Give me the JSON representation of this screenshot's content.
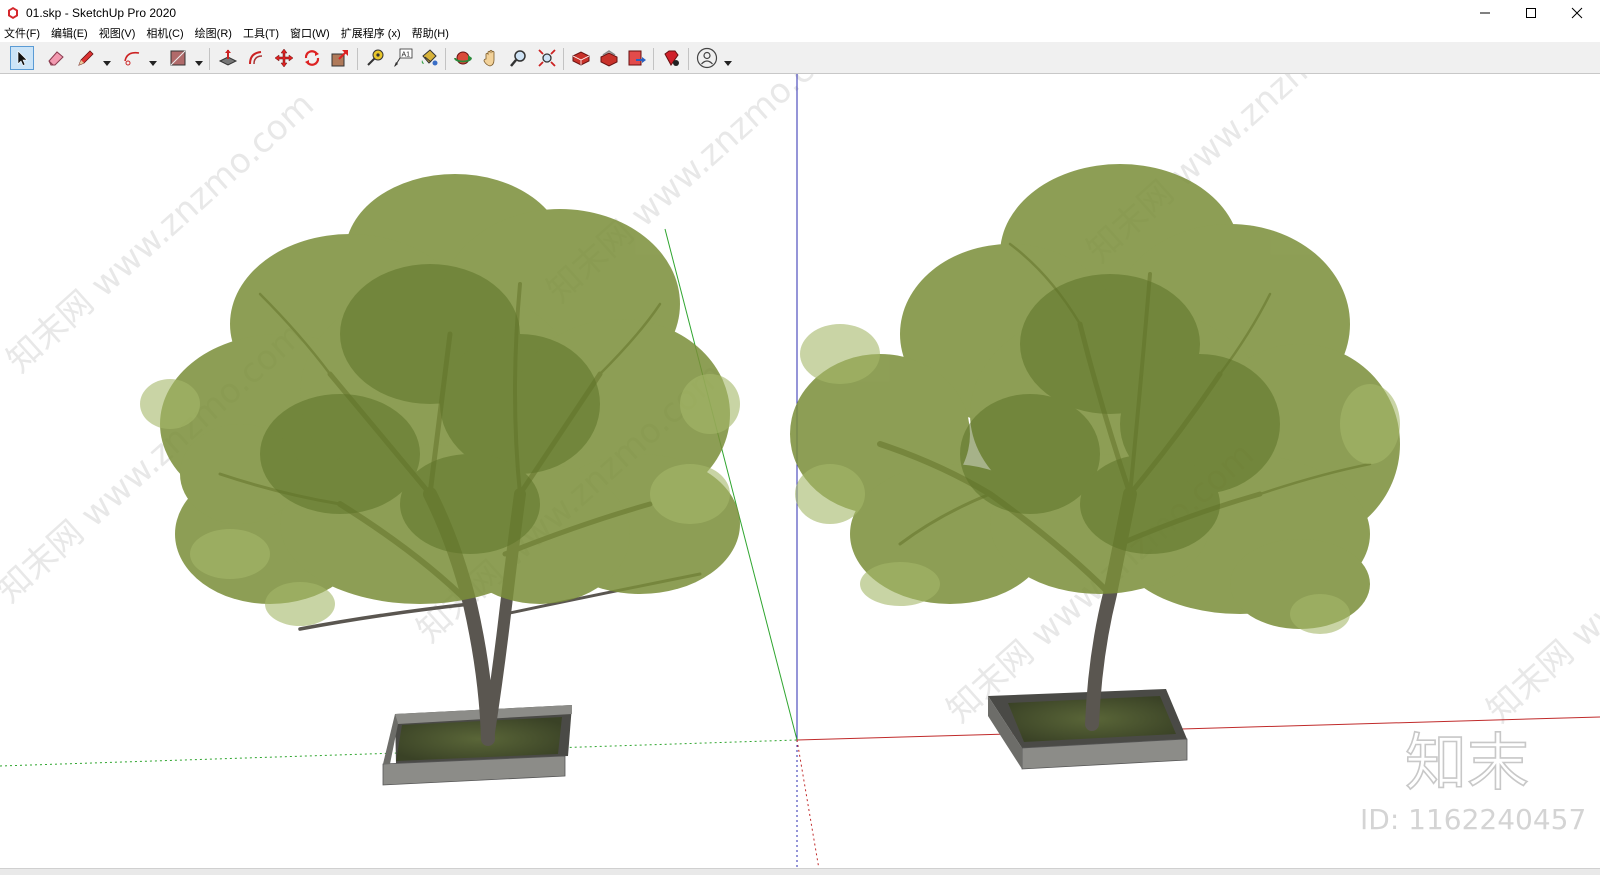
{
  "window": {
    "title": "01.skp - SketchUp Pro 2020",
    "controls": {
      "minimize": "—",
      "maximize": "☐",
      "close": "✕"
    }
  },
  "menubar": {
    "items": [
      {
        "label": "文件(F)"
      },
      {
        "label": "编辑(E)"
      },
      {
        "label": "视图(V)"
      },
      {
        "label": "相机(C)"
      },
      {
        "label": "绘图(R)"
      },
      {
        "label": "工具(T)"
      },
      {
        "label": "窗口(W)"
      },
      {
        "label": "扩展程序 (x)"
      },
      {
        "label": "帮助(H)"
      }
    ]
  },
  "toolbar": {
    "tools": [
      {
        "icon": "select-arrow-icon",
        "active": true
      },
      {
        "icon": "eraser-icon"
      },
      {
        "icon": "pencil-line-icon"
      },
      {
        "icon": "arc-icon"
      },
      {
        "icon": "rectangle-shape-icon"
      },
      {
        "icon": "push-pull-icon"
      },
      {
        "icon": "offset-icon"
      },
      {
        "icon": "move-icon"
      },
      {
        "icon": "rotate-icon"
      },
      {
        "icon": "scale-icon"
      },
      {
        "icon": "tape-measure-icon"
      },
      {
        "icon": "text-label-icon"
      },
      {
        "icon": "paint-bucket-icon"
      },
      {
        "icon": "orbit-icon"
      },
      {
        "icon": "pan-hand-icon"
      },
      {
        "icon": "zoom-icon"
      },
      {
        "icon": "zoom-extents-icon"
      },
      {
        "icon": "3d-warehouse-icon"
      },
      {
        "icon": "extension-warehouse-icon"
      },
      {
        "icon": "layout-send-icon"
      },
      {
        "icon": "extension-manager-ruby-icon"
      },
      {
        "icon": "account-user-icon"
      }
    ],
    "text_tool_glyph": "A1"
  },
  "viewport": {
    "colors": {
      "background": "#ffffff",
      "axis_red": "#c02b2b",
      "axis_green": "#2fa52f",
      "axis_blue": "#2b2bb0",
      "foliage": "#7b8f3a",
      "trunk": "#5a5650",
      "planter": "#8c8c88",
      "soil": "#4e5a32"
    },
    "watermark": {
      "repeat_text": "知末网 www.znzmo.com",
      "logo_text": "知末",
      "id_text": "ID: 1162240457"
    }
  }
}
